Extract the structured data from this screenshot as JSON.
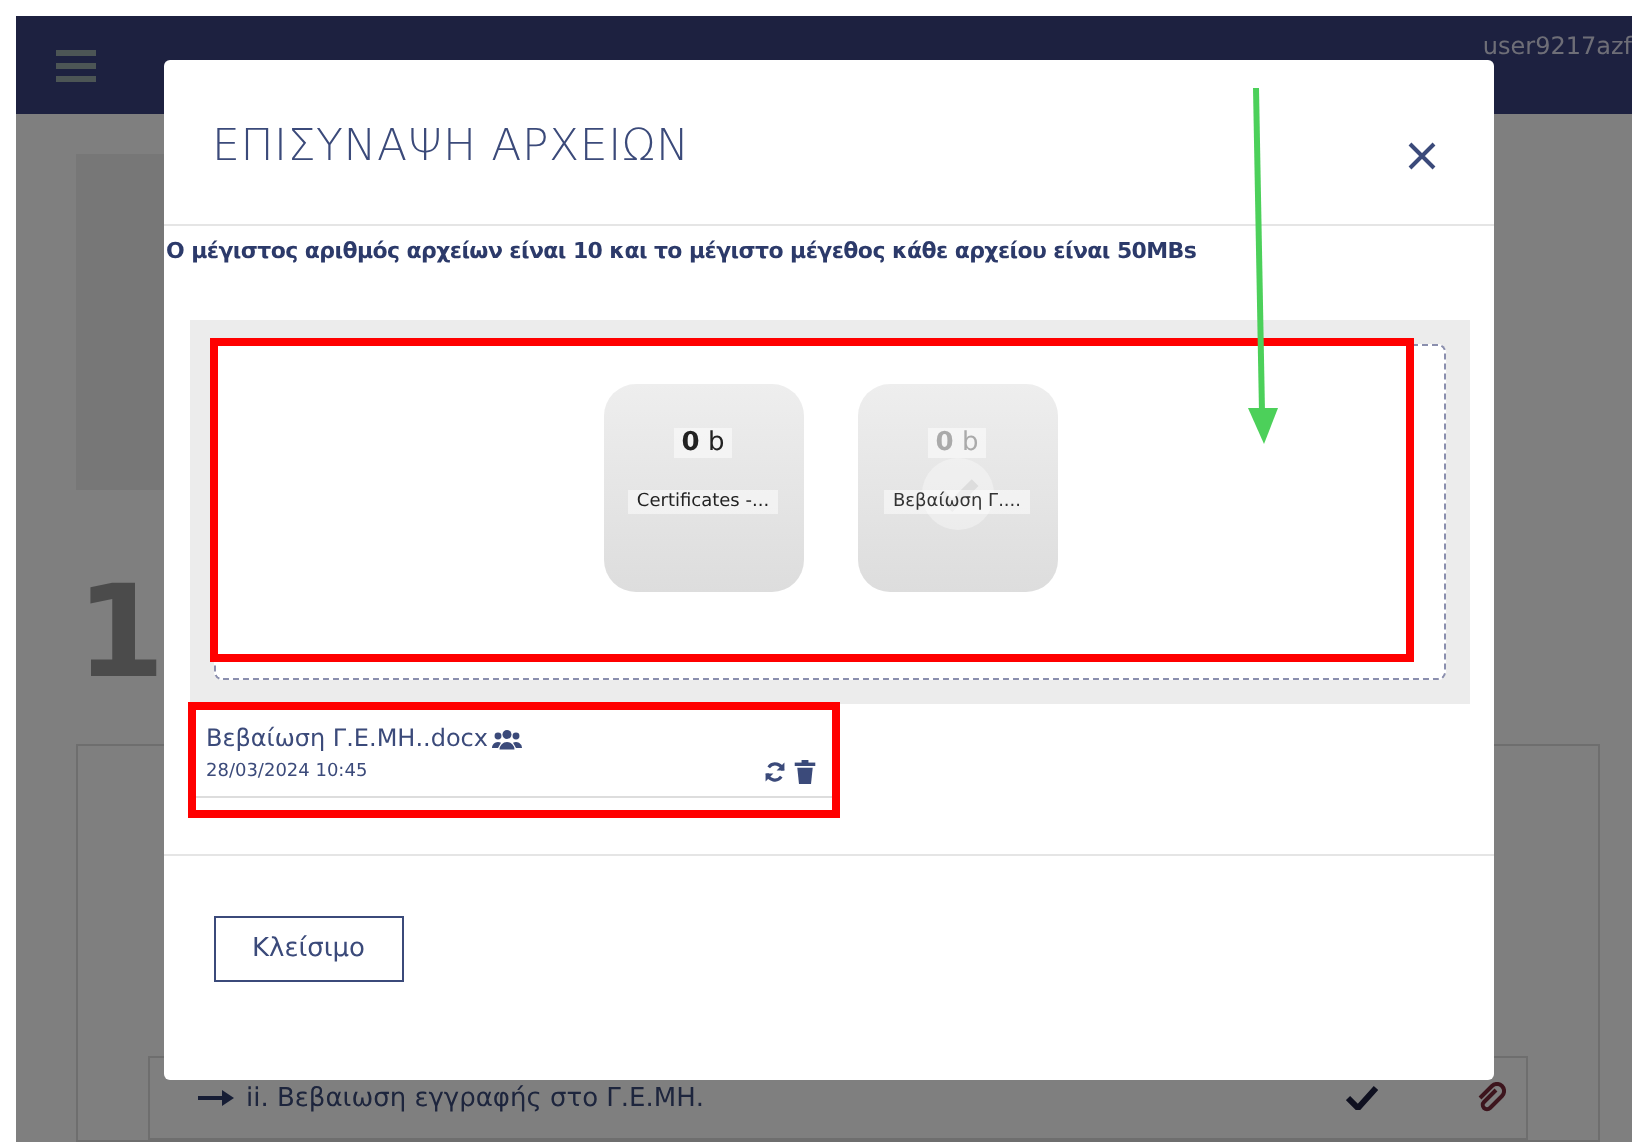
{
  "header": {
    "user": "user9217azf"
  },
  "background": {
    "step_number": "1",
    "row_text": "ii. Βεβαιωση εγγραφής στο Γ.Ε.ΜΗ.",
    "row_done": true
  },
  "modal": {
    "title": "ΕΠΙΣΥΝΑΨΗ ΑΡΧΕΙΩΝ",
    "info": "Ο μέγιστος αριθμός αρχείων είναι 10 και το μέγιστο μέγεθος κάθε αρχείου είναι 50MBs",
    "drop_zone": {
      "highlighted": true,
      "tiles": [
        {
          "size": "**0** b",
          "name": "Certificates -...",
          "uploaded": false
        },
        {
          "size": "**0** b",
          "name": "Βεβαίωση Γ....",
          "uploaded": true
        }
      ]
    },
    "files": [
      {
        "name": "Βεβαίωση Γ.Ε.ΜΗ..docx",
        "date": "28/03/2024 10:45",
        "shared": true,
        "highlighted": true
      }
    ],
    "close_button": "Κλείσιμο"
  },
  "annotation_arrow": true
}
